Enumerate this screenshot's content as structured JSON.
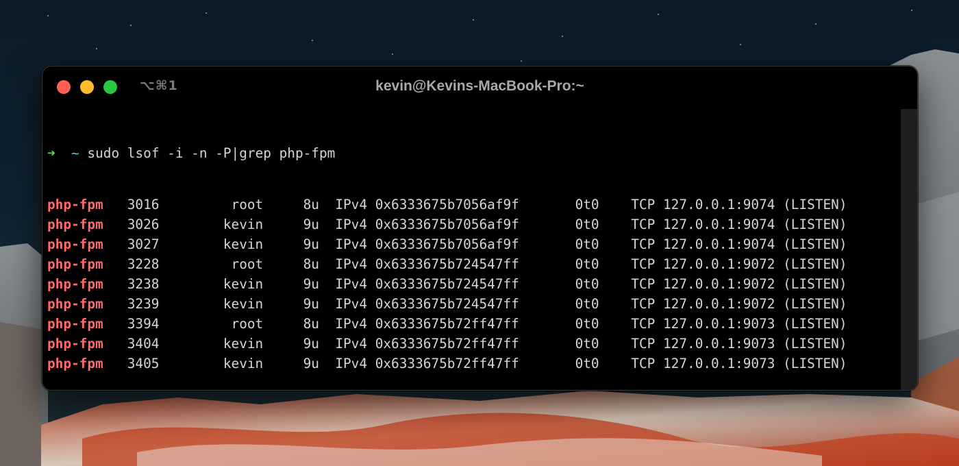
{
  "window": {
    "tab_shortcut": "⌥⌘1",
    "title": "kevin@Kevins-MacBook-Pro:~"
  },
  "terminal": {
    "prompt_arrow": "➜",
    "prompt_dir": "~",
    "command": "sudo lsof -i -n -P|grep php-fpm",
    "rows": [
      {
        "cmd": "php-fpm",
        "pid": "3016",
        "user": "root",
        "fd": "8u",
        "type": "IPv4",
        "device": "0x6333675b7056af9f",
        "size": "0t0",
        "node": "TCP",
        "name": "127.0.0.1:9074 (LISTEN)"
      },
      {
        "cmd": "php-fpm",
        "pid": "3026",
        "user": "kevin",
        "fd": "9u",
        "type": "IPv4",
        "device": "0x6333675b7056af9f",
        "size": "0t0",
        "node": "TCP",
        "name": "127.0.0.1:9074 (LISTEN)"
      },
      {
        "cmd": "php-fpm",
        "pid": "3027",
        "user": "kevin",
        "fd": "9u",
        "type": "IPv4",
        "device": "0x6333675b7056af9f",
        "size": "0t0",
        "node": "TCP",
        "name": "127.0.0.1:9074 (LISTEN)"
      },
      {
        "cmd": "php-fpm",
        "pid": "3228",
        "user": "root",
        "fd": "8u",
        "type": "IPv4",
        "device": "0x6333675b724547ff",
        "size": "0t0",
        "node": "TCP",
        "name": "127.0.0.1:9072 (LISTEN)"
      },
      {
        "cmd": "php-fpm",
        "pid": "3238",
        "user": "kevin",
        "fd": "9u",
        "type": "IPv4",
        "device": "0x6333675b724547ff",
        "size": "0t0",
        "node": "TCP",
        "name": "127.0.0.1:9072 (LISTEN)"
      },
      {
        "cmd": "php-fpm",
        "pid": "3239",
        "user": "kevin",
        "fd": "9u",
        "type": "IPv4",
        "device": "0x6333675b724547ff",
        "size": "0t0",
        "node": "TCP",
        "name": "127.0.0.1:9072 (LISTEN)"
      },
      {
        "cmd": "php-fpm",
        "pid": "3394",
        "user": "root",
        "fd": "8u",
        "type": "IPv4",
        "device": "0x6333675b72ff47ff",
        "size": "0t0",
        "node": "TCP",
        "name": "127.0.0.1:9073 (LISTEN)"
      },
      {
        "cmd": "php-fpm",
        "pid": "3404",
        "user": "kevin",
        "fd": "9u",
        "type": "IPv4",
        "device": "0x6333675b72ff47ff",
        "size": "0t0",
        "node": "TCP",
        "name": "127.0.0.1:9073 (LISTEN)"
      },
      {
        "cmd": "php-fpm",
        "pid": "3405",
        "user": "kevin",
        "fd": "9u",
        "type": "IPv4",
        "device": "0x6333675b72ff47ff",
        "size": "0t0",
        "node": "TCP",
        "name": "127.0.0.1:9073 (LISTEN)"
      }
    ]
  },
  "colors": {
    "close": "#fe5f57",
    "minimize": "#febc2e",
    "maximize": "#28c840",
    "prompt_arrow": "#5fd75f",
    "prompt_dir": "#56c8dd",
    "process_name": "#ff6b6b",
    "output_text": "#d6d6d6"
  }
}
